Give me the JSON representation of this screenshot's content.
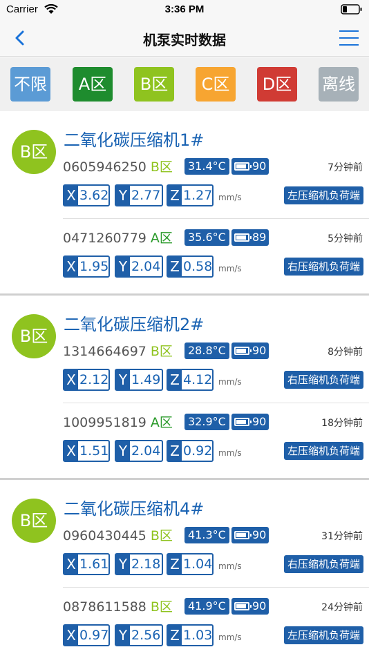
{
  "status": {
    "carrier": "Carrier",
    "time": "3:36 PM"
  },
  "nav": {
    "title": "机泵实时数据"
  },
  "filters": [
    {
      "label": "不限",
      "color": "#5b9bd5"
    },
    {
      "label": "A区",
      "color": "#1e8c2e"
    },
    {
      "label": "B区",
      "color": "#8fc31f"
    },
    {
      "label": "C区",
      "color": "#f7a531"
    },
    {
      "label": "D区",
      "color": "#d03b34"
    },
    {
      "label": "离线",
      "color": "#a7b1b8"
    }
  ],
  "unit": "mm/s",
  "machines": [
    {
      "zone": "B区",
      "name": "二氧化碳压缩机1#",
      "sensors": [
        {
          "id": "0605946250",
          "zone": "B区",
          "temp": "31.4°C",
          "battery": "90",
          "ago": "7分钟前",
          "x": "3.62",
          "y": "2.77",
          "z": "1.27",
          "position": "左压缩机负荷端"
        },
        {
          "id": "0471260779",
          "zone": "A区",
          "temp": "35.6°C",
          "battery": "89",
          "ago": "5分钟前",
          "x": "1.95",
          "y": "2.04",
          "z": "0.58",
          "position": "右压缩机负荷端"
        }
      ]
    },
    {
      "zone": "B区",
      "name": "二氧化碳压缩机2#",
      "sensors": [
        {
          "id": "1314664697",
          "zone": "B区",
          "temp": "28.8°C",
          "battery": "90",
          "ago": "8分钟前",
          "x": "2.12",
          "y": "1.49",
          "z": "4.12",
          "position": "右压缩机负荷端"
        },
        {
          "id": "1009951819",
          "zone": "A区",
          "temp": "32.9°C",
          "battery": "90",
          "ago": "18分钟前",
          "x": "1.51",
          "y": "2.04",
          "z": "0.92",
          "position": "左压缩机负荷端"
        }
      ]
    },
    {
      "zone": "B区",
      "name": "二氧化碳压缩机4#",
      "sensors": [
        {
          "id": "0960430445",
          "zone": "B区",
          "temp": "41.3°C",
          "battery": "90",
          "ago": "31分钟前",
          "x": "1.61",
          "y": "2.18",
          "z": "1.04",
          "position": "右压缩机负荷端"
        },
        {
          "id": "0878611588",
          "zone": "B区",
          "temp": "41.9°C",
          "battery": "90",
          "ago": "24分钟前",
          "x": "0.97",
          "y": "2.56",
          "z": "1.03",
          "position": "左压缩机负荷端"
        }
      ]
    }
  ]
}
